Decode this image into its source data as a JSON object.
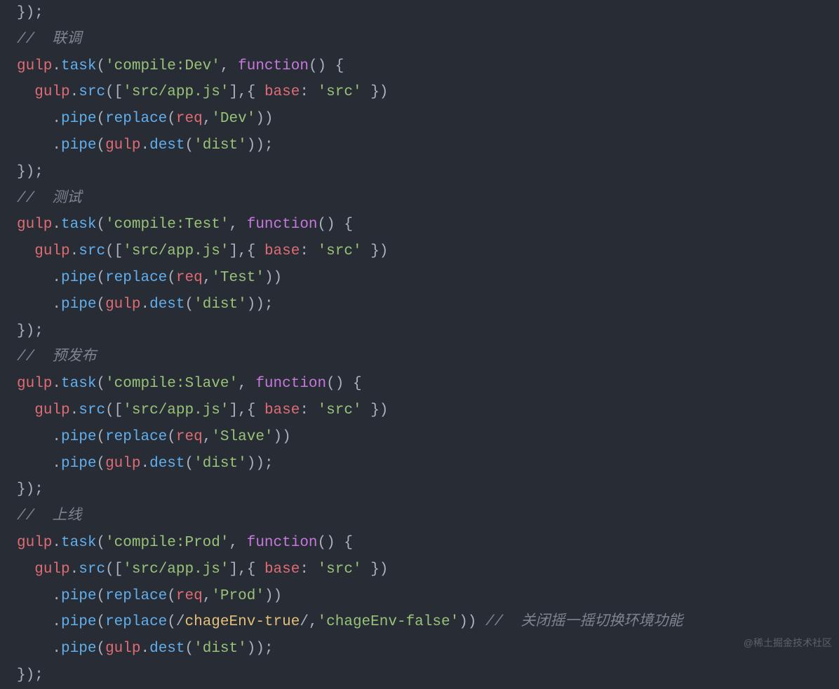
{
  "watermark": "@稀土掘金技术社区",
  "strings": {
    "srcapp": "'src/app.js'",
    "src": "'src'",
    "dist": "'dist'"
  },
  "keywords": {
    "function": "function",
    "base": "base"
  },
  "identifiers": {
    "gulp": "gulp",
    "req": "req",
    "task": "task",
    "srcfn": "src",
    "pipe": "pipe",
    "replace": "replace",
    "dest": "dest"
  },
  "blocks": [
    {
      "comment": "//  联调",
      "taskName": "'compile:Dev'",
      "envString": "'Dev'",
      "extraReplace": null
    },
    {
      "comment": "//  测试",
      "taskName": "'compile:Test'",
      "envString": "'Test'",
      "extraReplace": null
    },
    {
      "comment": "//  预发布",
      "taskName": "'compile:Slave'",
      "envString": "'Slave'",
      "extraReplace": null
    },
    {
      "comment": "//  上线",
      "taskName": "'compile:Prod'",
      "envString": "'Prod'",
      "extraReplace": {
        "regex": "chageEnv-true",
        "replacement": "'chageEnv-false'",
        "trailComment": "//  关闭摇一摇切换环境功能"
      }
    }
  ]
}
